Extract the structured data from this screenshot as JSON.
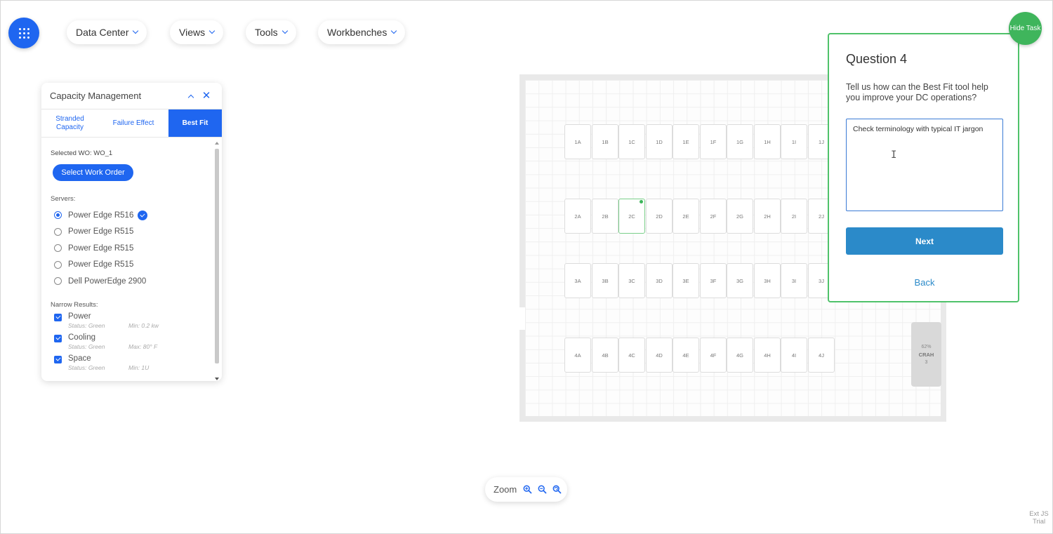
{
  "topnav": {
    "menus": [
      {
        "label": "Data Center"
      },
      {
        "label": "Views"
      },
      {
        "label": "Tools"
      },
      {
        "label": "Workbenches"
      }
    ]
  },
  "capacity": {
    "title": "Capacity Management",
    "tabs": [
      {
        "label": "Stranded Capacity"
      },
      {
        "label": "Failure Effect"
      },
      {
        "label": "Best Fit",
        "active": true
      }
    ],
    "selected_wo": "Selected WO: WO_1",
    "select_button": "Select Work Order",
    "servers_label": "Servers:",
    "servers": [
      {
        "name": "Power Edge R516",
        "selected": true
      },
      {
        "name": "Power Edge R515",
        "selected": false
      },
      {
        "name": "Power Edge R515",
        "selected": false
      },
      {
        "name": "Power Edge R515",
        "selected": false
      },
      {
        "name": "Dell PowerEdge 2900",
        "selected": false
      }
    ],
    "narrow_label": "Narrow Results:",
    "narrow": [
      {
        "name": "Power",
        "status": "Status: Green",
        "limit": "Min: 0.2 kw",
        "checked": true
      },
      {
        "name": "Cooling",
        "status": "Status: Green",
        "limit": "Max: 80° F",
        "checked": true
      },
      {
        "name": "Space",
        "status": "Status: Green",
        "limit": "Min: 1U",
        "checked": true
      }
    ]
  },
  "floor": {
    "rows": [
      [
        "1A",
        "1B",
        "1C",
        "1D",
        "1E",
        "1F",
        "1G",
        "1H",
        "1I",
        "1J"
      ],
      [
        "2A",
        "2B",
        "2C",
        "2D",
        "2E",
        "2F",
        "2G",
        "2H",
        "2I",
        "2J"
      ],
      [
        "3A",
        "3B",
        "3C",
        "3D",
        "3E",
        "3F",
        "3G",
        "3H",
        "3I",
        "3J"
      ],
      [
        "4A",
        "4B",
        "4C",
        "4D",
        "4E",
        "4F",
        "4G",
        "4H",
        "4I",
        "4J"
      ]
    ],
    "selected_rack": "2C",
    "crah": {
      "percent": "62%",
      "name": "CRAH",
      "number": "3"
    }
  },
  "zoom": {
    "label": "Zoom"
  },
  "question": {
    "title": "Question 4",
    "text": "Tell us how can the Best Fit tool help you improve your DC operations?",
    "answer": "Check terminology with typical IT jargon",
    "next_label": "Next",
    "back_label": "Back",
    "hide_task_label": "Hide Task"
  },
  "watermark": "Ext JS Trial",
  "colors": {
    "accent": "#1f66f0",
    "task_green": "#3fb55c",
    "next_blue": "#2b8ac9"
  }
}
